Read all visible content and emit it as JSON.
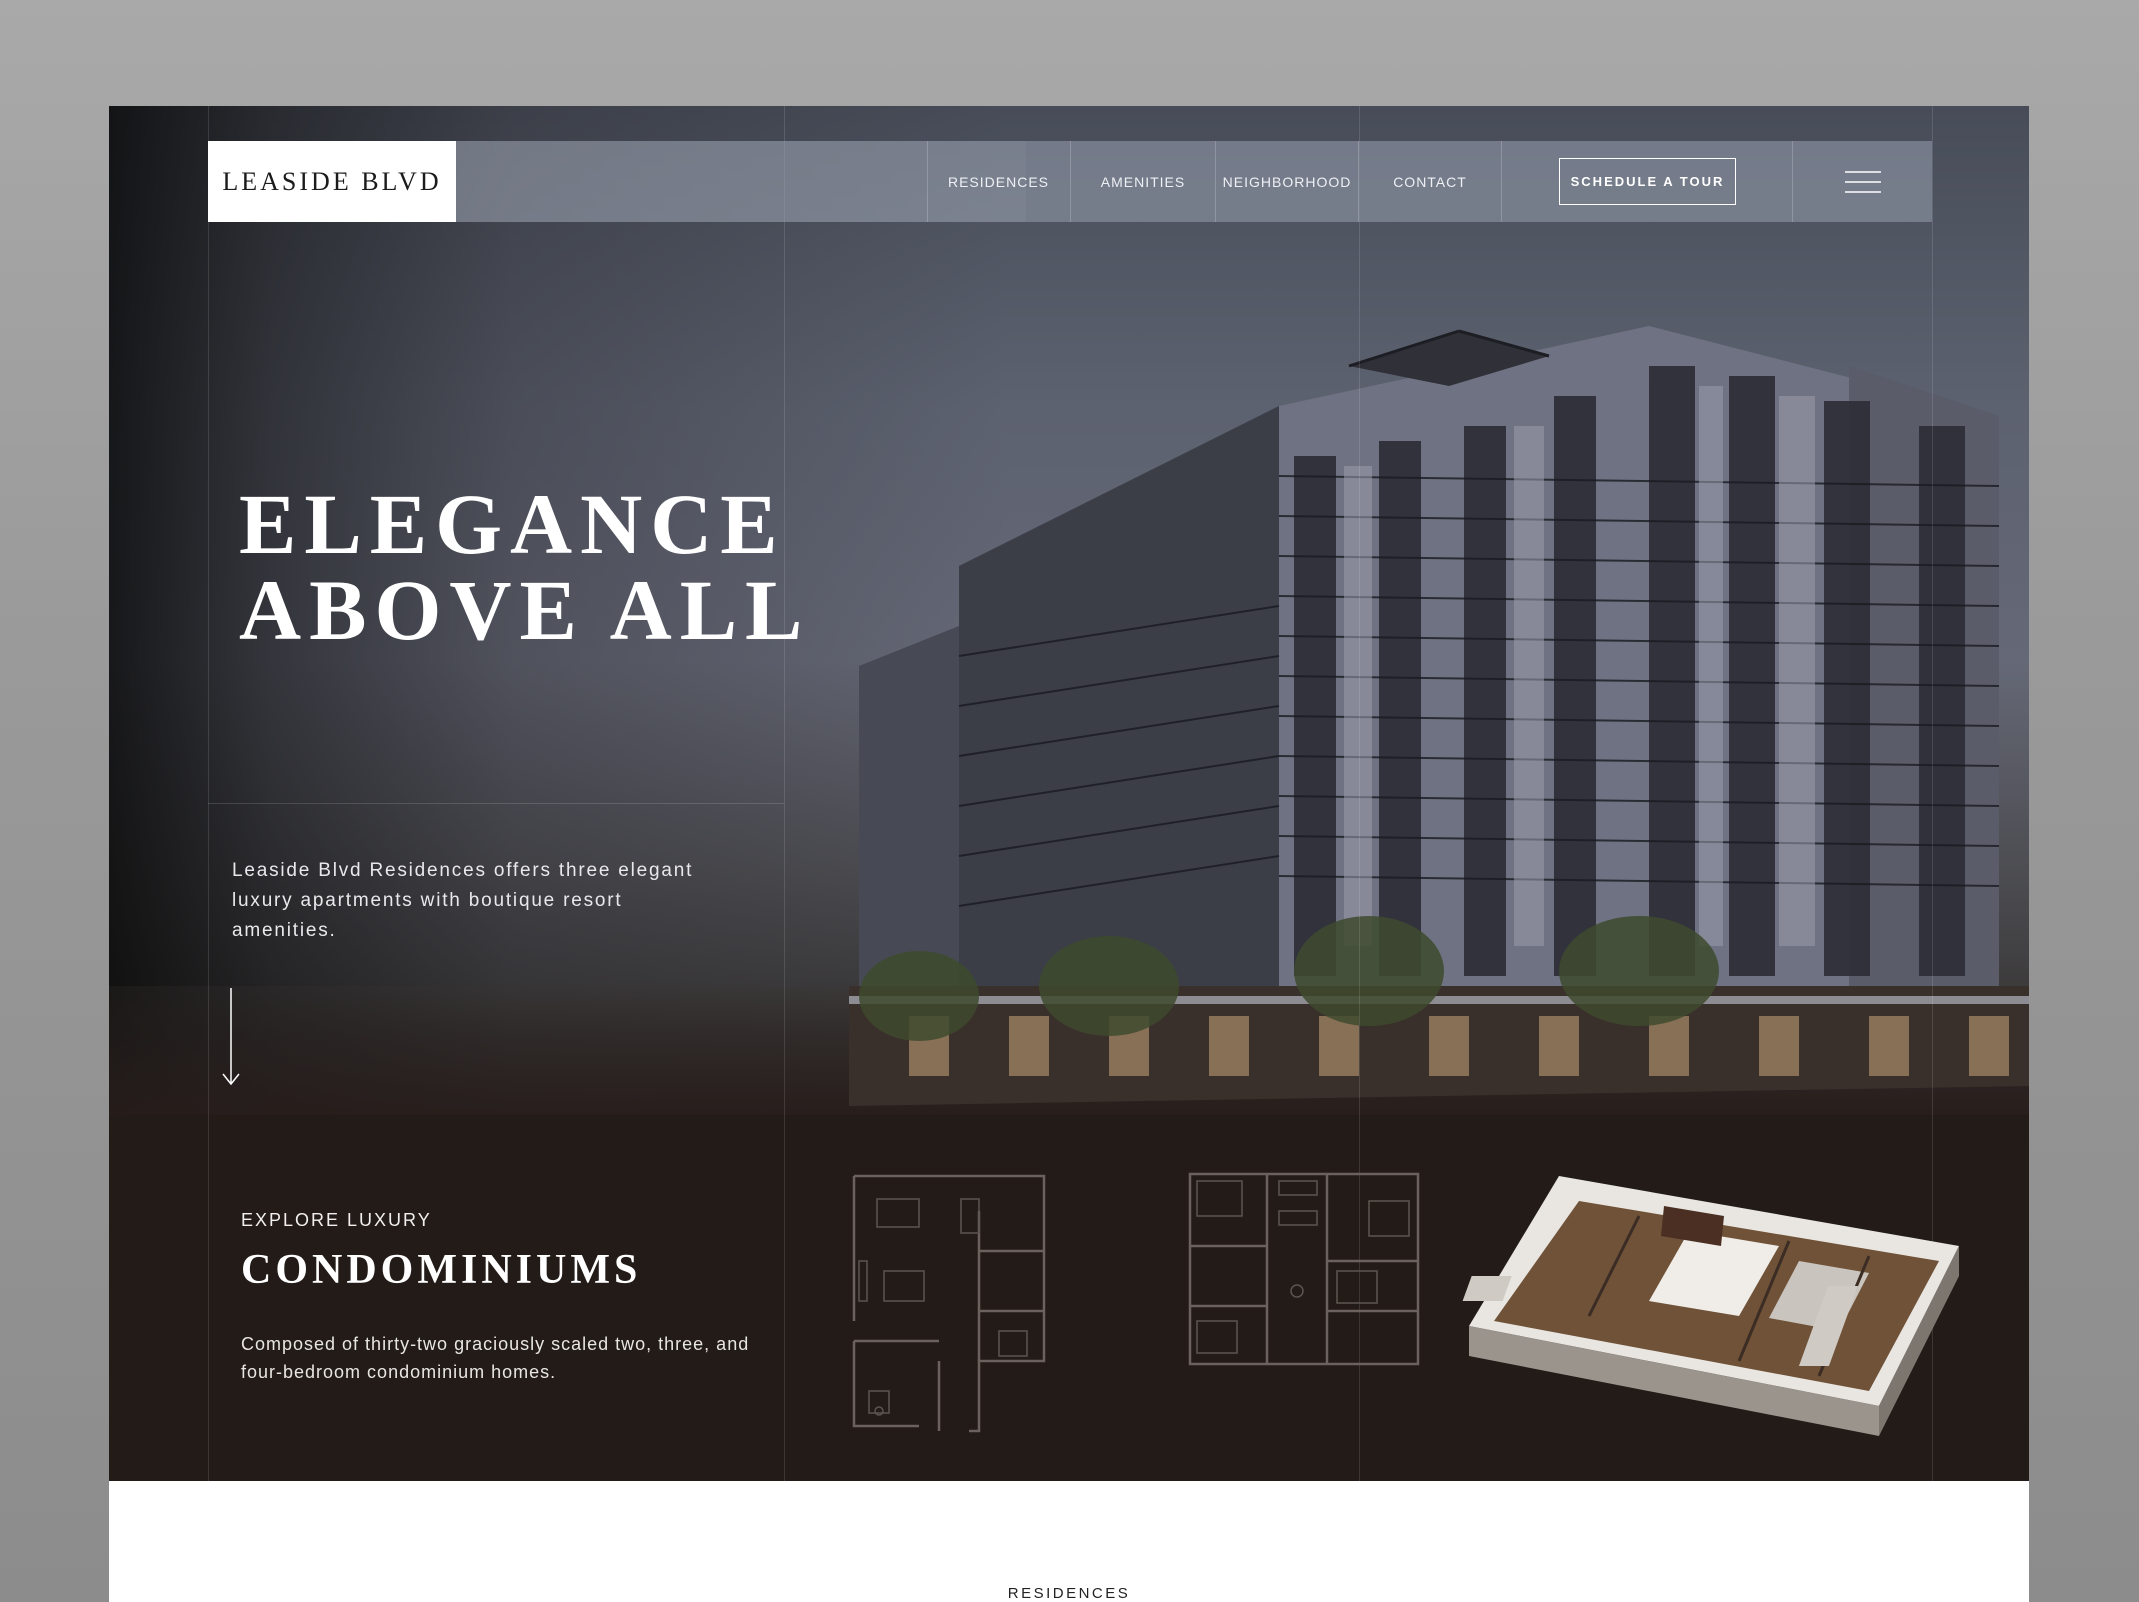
{
  "brand": {
    "logo_text": "LEASIDE BLVD"
  },
  "nav": {
    "items": [
      {
        "label": "RESIDENCES"
      },
      {
        "label": "AMENITIES"
      },
      {
        "label": "NEIGHBORHOOD"
      },
      {
        "label": "CONTACT"
      }
    ],
    "cta_label": "SCHEDULE A TOUR",
    "menu_icon": "hamburger-menu-icon"
  },
  "hero": {
    "headline_line1": "ELEGANCE",
    "headline_line2": "ABOVE ALL",
    "description": "Leaside Blvd Residences offers three elegant luxury apartments with boutique resort amenities.",
    "scroll_icon": "arrow-down-icon"
  },
  "condos": {
    "eyebrow": "EXPLORE LUXURY",
    "title": "CONDOMINIUMS",
    "description": "Composed of thirty-two graciously scaled two, three, and four-bedroom condominium homes."
  },
  "residences": {
    "section_label": "RESIDENCES"
  },
  "colors": {
    "dark_section": "#221b18",
    "page_background": "#a3a3a3",
    "accent_text": "#ffffff"
  }
}
